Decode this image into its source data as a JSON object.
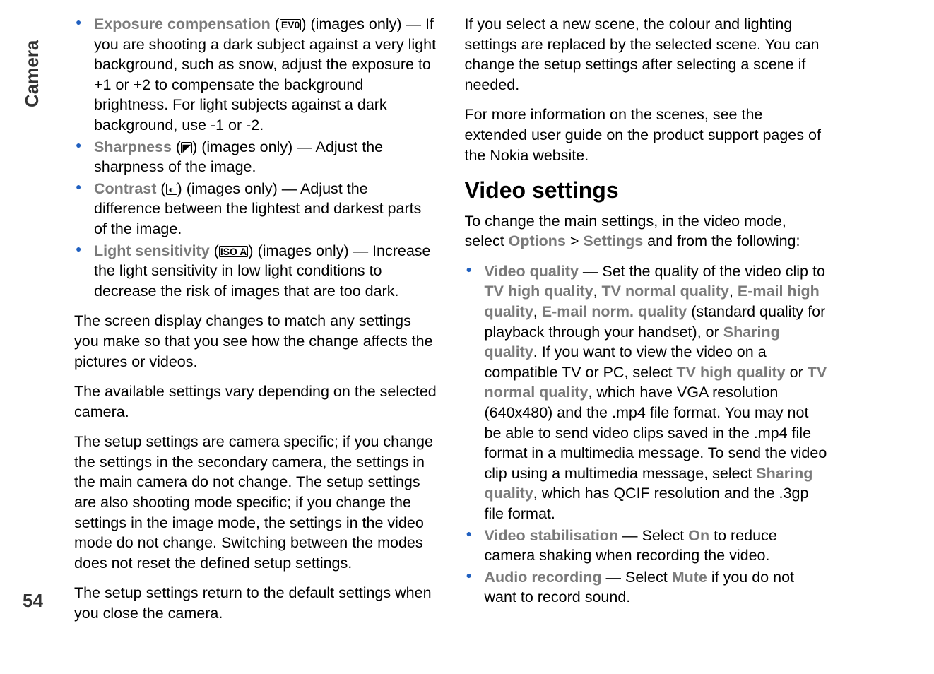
{
  "side_tab": "Camera",
  "page_number": "54",
  "left_bullets": [
    {
      "name": "exposure-compensation",
      "keyword": "Exposure compensation",
      "icon": "EV0",
      "rest": " (images only) — If you are shooting a dark subject against a very light background, such as snow, adjust the exposure to +1 or +2 to compensate the background brightness. For light subjects against a dark background, use -1 or -2."
    },
    {
      "name": "sharpness",
      "keyword": "Sharpness",
      "icon": "◤",
      "rest": " (images only)  — Adjust the sharpness of the image."
    },
    {
      "name": "contrast",
      "keyword": "Contrast",
      "icon": "◐",
      "rest": " (images only)  — Adjust the difference between the lightest and darkest parts of the image."
    },
    {
      "name": "light-sensitivity",
      "keyword": "Light sensitivity",
      "icon": "ISO A",
      "rest": " (images only)  — Increase the light sensitivity in low light conditions to decrease the risk of images that are too dark."
    }
  ],
  "left_paras": [
    "The screen display changes to match any settings you make so that you see how the change affects the pictures or videos.",
    "The available settings vary depending on the selected camera.",
    "The setup settings are camera specific; if you change the settings in the secondary camera, the settings in the main camera do not change. The setup settings are also shooting mode specific; if you change the settings in the image mode, the settings in the video mode do not change. Switching between the modes does not reset the defined setup settings.",
    "The setup settings return to the default settings when you close the camera."
  ],
  "right_top_paras": [
    "If you select a new scene, the colour and lighting settings are replaced by the selected scene. You can change the setup settings after selecting a scene if needed.",
    "For more information on the scenes, see the extended user guide on the product support pages of the Nokia website."
  ],
  "video_heading": "Video settings",
  "video_intro_pre": "To change the main settings, in the video mode, select ",
  "video_intro_kw1": "Options",
  "video_intro_sep": " > ",
  "video_intro_kw2": "Settings",
  "video_intro_post": " and from the following:",
  "video_bullets": [
    {
      "name": "video-quality",
      "keyword": "Video quality",
      "segments": [
        {
          "t": "  — Set the quality of the video clip to "
        },
        {
          "kw": "TV high quality"
        },
        {
          "t": ", "
        },
        {
          "kw": "TV normal quality"
        },
        {
          "t": ", "
        },
        {
          "kw": "E-mail high quality"
        },
        {
          "t": ", "
        },
        {
          "kw": "E-mail norm. quality"
        },
        {
          "t": " (standard quality for playback through your handset), or "
        },
        {
          "kw": "Sharing quality"
        },
        {
          "t": ". If you want to view the video on a compatible TV or PC, select "
        },
        {
          "kw": "TV high quality"
        },
        {
          "t": " or "
        },
        {
          "kw": "TV normal quality"
        },
        {
          "t": ", which have VGA resolution (640x480) and the .mp4 file format. You may not be able to send video clips saved in the .mp4 file format in a multimedia message. To send the video clip using a multimedia message, select "
        },
        {
          "kw": "Sharing quality"
        },
        {
          "t": ", which has QCIF resolution and the .3gp file format."
        }
      ]
    },
    {
      "name": "video-stabilisation",
      "keyword": "Video stabilisation",
      "segments": [
        {
          "t": "  — Select "
        },
        {
          "kw": "On"
        },
        {
          "t": " to reduce camera shaking when recording the video."
        }
      ]
    },
    {
      "name": "audio-recording",
      "keyword": "Audio recording",
      "segments": [
        {
          "t": "  — Select "
        },
        {
          "kw": "Mute"
        },
        {
          "t": " if you do not want to record sound."
        }
      ]
    }
  ]
}
